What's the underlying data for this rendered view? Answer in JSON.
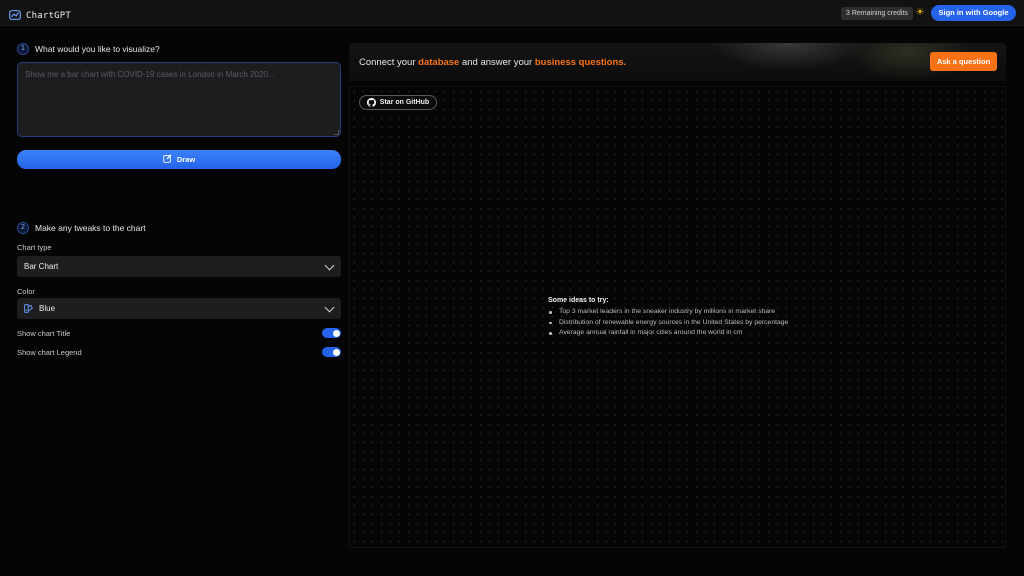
{
  "header": {
    "app_name": "ChartGPT",
    "credits": "3 Remaining credits",
    "theme_icon": "sun-icon",
    "signin_label": "Sign in with Google"
  },
  "step1": {
    "number": "1",
    "label": "What would you like to visualize?",
    "prompt_value": "",
    "prompt_placeholder": "Show me a bar chart with COVID-19 cases in London in March 2020...",
    "draw_label": "Draw"
  },
  "step2": {
    "number": "2",
    "label": "Make any tweaks to the chart",
    "chart_type_label": "Chart type",
    "chart_type_value": "Bar Chart",
    "color_label": "Color",
    "color_value": "Blue",
    "show_title_label": "Show chart Title",
    "show_title_on": true,
    "show_legend_label": "Show chart Legend",
    "show_legend_on": true
  },
  "banner": {
    "text_1": "Connect your ",
    "highlight_1": "database",
    "text_2": " and answer your ",
    "highlight_2": "business questions.",
    "ask_label": "Ask a question"
  },
  "canvas": {
    "github_label": "Star on GitHub",
    "ideas_title": "Some ideas to try:",
    "ideas": [
      "Top 3 market leaders in the sneaker industry by millions in market share",
      "Distribution of renewable energy sources in the United States by percentage",
      "Average annual rainfall in major cities around the world in cm"
    ]
  },
  "colors": {
    "accent_blue": "#2563eb",
    "accent_orange": "#f97316",
    "background": "#050505"
  }
}
